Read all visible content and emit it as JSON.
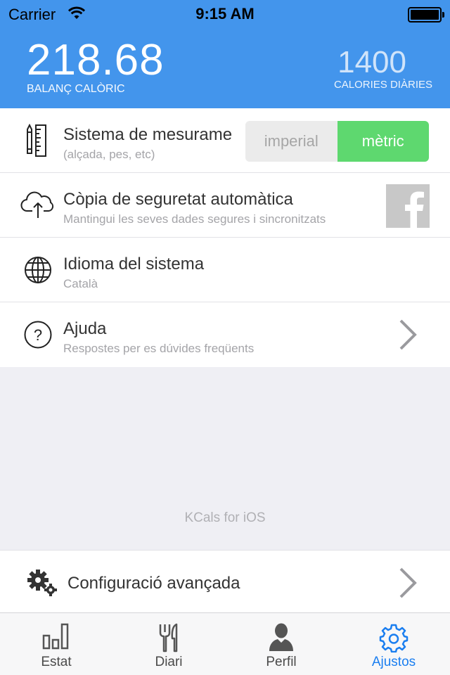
{
  "status_bar": {
    "carrier": "Carrier",
    "time": "9:15 AM"
  },
  "header": {
    "balance_value": "218.68",
    "balance_label": "BALANÇ CALÒRIC",
    "daily_value": "1400",
    "daily_label": "CALORIES DIÀRIES",
    "color": "#4395ec"
  },
  "settings": [
    {
      "title": "Sistema de mesurame",
      "subtitle": "(alçada, pes, etc)",
      "icon": "ruler-pencil-icon"
    },
    {
      "title": "Còpia de seguretat automàtica",
      "subtitle": "Mantingui les seves dades segures i sincronitzats",
      "icon": "cloud-upload-icon"
    },
    {
      "title": "Idioma del sistema",
      "subtitle": "Català",
      "icon": "globe-icon"
    },
    {
      "title": "Ajuda",
      "subtitle": "Respostes per es dúvides freqüents",
      "icon": "help-icon"
    }
  ],
  "units_toggle": {
    "options": [
      "imperial",
      "mètric"
    ],
    "selected": "mètric",
    "selected_color": "#5ed86f"
  },
  "footer_text": "KCals for iOS",
  "advanced": {
    "title": "Configuració avançada",
    "icon": "gears-icon"
  },
  "tabs": [
    {
      "label": "Estat",
      "icon": "bar-chart-icon",
      "active": false
    },
    {
      "label": "Diari",
      "icon": "fork-knife-icon",
      "active": false
    },
    {
      "label": "Perfil",
      "icon": "person-icon",
      "active": false
    },
    {
      "label": "Ajustos",
      "icon": "gear-icon",
      "active": true
    }
  ],
  "accent_color": "#1a7ef0"
}
